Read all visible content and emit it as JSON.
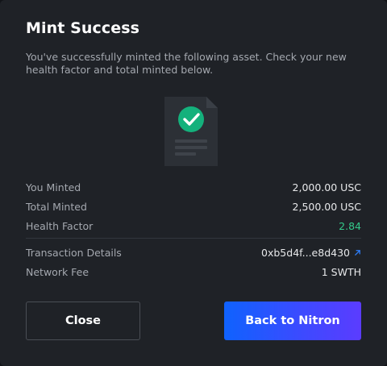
{
  "modal": {
    "title": "Mint Success",
    "description": "You've successfully minted the following asset. Check your new health factor and total minted below.",
    "illustration_icon": "document-check-icon"
  },
  "details": {
    "you_minted": {
      "label": "You Minted",
      "value": "2,000.00 USC"
    },
    "total_minted": {
      "label": "Total Minted",
      "value": "2,500.00 USC"
    },
    "health_factor": {
      "label": "Health Factor",
      "value": "2.84",
      "color": "#34c98a"
    },
    "transaction": {
      "label": "Transaction Details",
      "value": "0xb5d4f...e8d430",
      "icon": "external-link-icon"
    },
    "network_fee": {
      "label": "Network Fee",
      "value": "1 SWTH"
    }
  },
  "buttons": {
    "close_label": "Close",
    "back_label": "Back to Nitron"
  },
  "colors": {
    "background": "#1f2227",
    "accent_green": "#34c98a",
    "link_blue": "#2f80ff",
    "primary_gradient_start": "#0f62fe",
    "primary_gradient_end": "#5b3cff"
  }
}
